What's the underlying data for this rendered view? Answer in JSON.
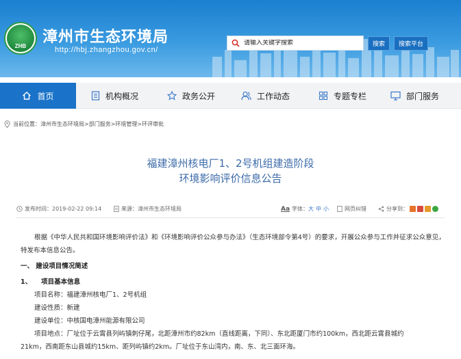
{
  "header": {
    "site_title": "漳州市生态环境局",
    "site_url": "http://hbj.zhangzhou.gov.cn/",
    "logo_text": "ZHB",
    "search_placeholder": "请输入关键字搜索",
    "search_button": "搜索",
    "platform_button": "搜索平台",
    "brand_color": "#1a73c8"
  },
  "nav": {
    "items": [
      {
        "label": "首页",
        "icon": "home-icon"
      },
      {
        "label": "机构概况",
        "icon": "document-icon"
      },
      {
        "label": "政务公开",
        "icon": "star-icon"
      },
      {
        "label": "工作动态",
        "icon": "people-icon"
      },
      {
        "label": "专题专栏",
        "icon": "grid-icon"
      },
      {
        "label": "部门服务",
        "icon": "monitor-icon"
      }
    ]
  },
  "breadcrumb": {
    "label": "当前位置：",
    "path": "漳州市生态环境局>部门服务>环境管理>环评审批"
  },
  "article": {
    "title_line1": "福建漳州核电厂1、2号机组建造阶段",
    "title_line2": "环境影响评价信息公告",
    "publish_time": "发布时间：2019-02-22 09:14",
    "source": "来源：漳州市生态环境局",
    "font_label": "字体：",
    "font_sizes": [
      "大",
      "中",
      "小"
    ],
    "font_icon_text": "Aa",
    "error_report": "网页纠错",
    "share_label": "分享到：",
    "intro": "根据《中华人民共和国环境影响评价法》和《环境影响评价公众参与办法》（生态环境部令第4号）的要求，开展公众参与工作并征求公众意见，特发布本信息公告。",
    "section1": "一、 建设项目情况简述",
    "subsection1_num": "1、",
    "subsection1_title": "项目基本信息",
    "project_name": "项目名称：福建漳州核电厂1、2号机组",
    "project_nature": "建设性质：新建",
    "project_unit": "建设单位：中核国电漳州能源有限公司",
    "project_location_1": "项目地点：厂址位于云霄县列屿镇刺仔尾，北距漳州市约82km（直线距离，下同）、东北距厦门市约100km，西北距云霄县城约",
    "project_location_2": "21km，西南距东山县城约15km、距列屿镇约2km。厂址位于东山湾内，南、东、北三面环海。"
  }
}
